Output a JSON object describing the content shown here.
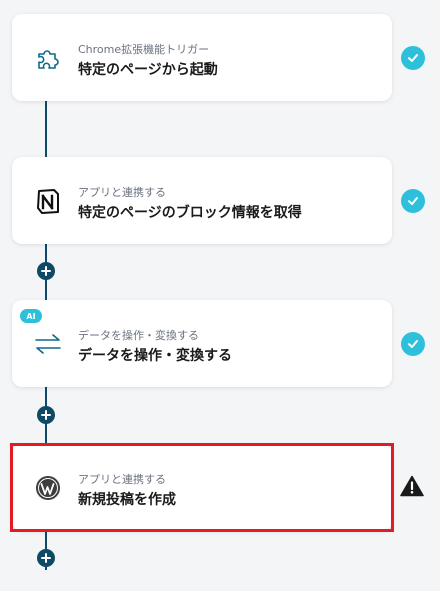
{
  "steps": [
    {
      "sub": "Chrome拡張機能トリガー",
      "title": "特定のページから起動",
      "icon": "puzzle-piece-icon",
      "status": "done"
    },
    {
      "sub": "アプリと連携する",
      "title": "特定のページのブロック情報を取得",
      "icon": "notion-icon",
      "status": "done"
    },
    {
      "sub": "データを操作・変換する",
      "title": "データを操作・変換する",
      "icon": "swap-arrows-icon",
      "status": "done",
      "badge": "AI"
    },
    {
      "sub": "アプリと連携する",
      "title": "新規投稿を作成",
      "icon": "wordpress-icon",
      "status": "warning"
    }
  ],
  "colors": {
    "accent": "#2ec0da",
    "rail": "#0e4a66",
    "highlight": "#e31b23",
    "background": "#f4f5f7"
  }
}
